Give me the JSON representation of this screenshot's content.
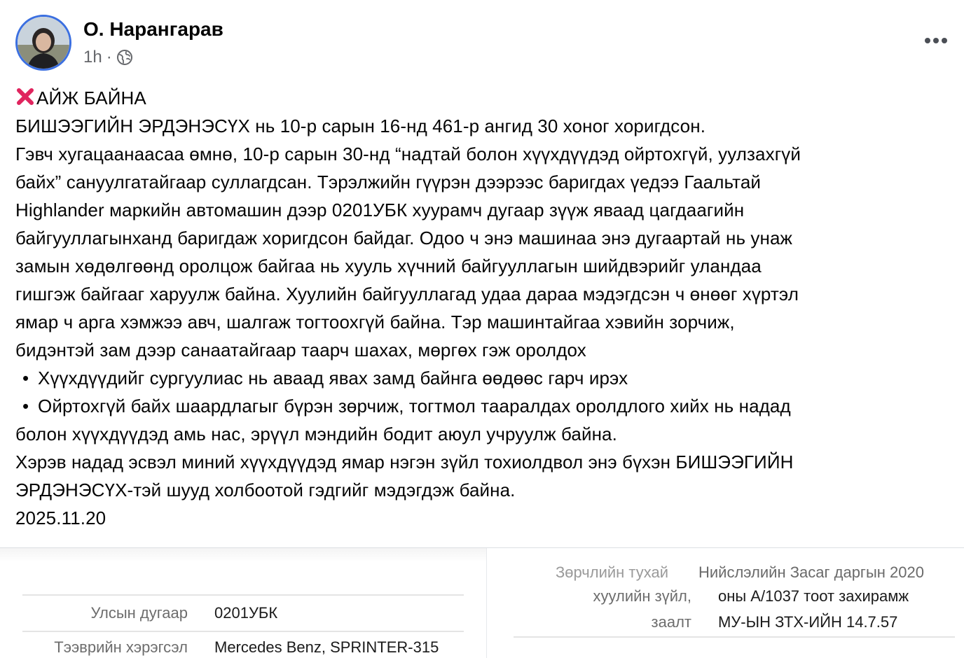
{
  "post": {
    "author": "О. Нарангарав",
    "time": "1h",
    "separator": "·",
    "privacy_icon": "globe-icon",
    "more_icon": "more-options-icon",
    "lines": {
      "title": "АЙЖ БАЙНА",
      "l1": "БИШЭЭГИЙН ЭРДЭНЭСҮХ нь 10-р сарын 16-нд 461-р ангид 30 хоног хоригдсон.",
      "l2": "Гэвч хугацаанаасаа өмнө, 10-р сарын 30-нд “надтай болон хүүхдүүдэд ойртохгүй, уулзахгүй",
      "l3": "байх” сануулгатайгаар суллагдсан. Тэрэлжийн гүүрэн дээрээс баригдах үедээ Гаальтай",
      "l4": "Highlander маркийн автомашин дээр 0201УБК хуурамч дугаар зүүж яваад цагдаагийн",
      "l5": "байгууллагынханд баригдаж хоригдсон байдаг. Одоо ч энэ машинаа энэ дугаартай нь унаж",
      "l6": "замын хөдөлгөөнд оролцож байгаа нь хууль хүчний байгууллагын шийдвэрийг уландаа",
      "l7": "гишгэж байгааг харуулж байна. Хуулийн байгууллагад удаа дараа мэдэгдсэн ч өнөөг хүртэл",
      "l8": "ямар ч арга хэмжээ авч, шалгаж тогтоохгүй байна. Тэр машинтайгаа хэвийн зорчиж,",
      "l9": "бидэнтэй зам дээр санаатайгаар таарч шахах, мөргөх гэж оролдох",
      "b1": "Хүүхдүүдийг сургуулиас нь аваад явах замд байнга өөдөөс гарч ирэх",
      "b2": "Ойртохгүй байх шаардлагыг бүрэн зөрчиж, тогтмол тааралдах оролдлого хийх  нь надад",
      "l10": "болон хүүхдүүдэд амь нас, эрүүл мэндийн бодит аюул учруулж байна.",
      "l11": "Хэрэв надад эсвэл миний хүүхдүүдэд ямар нэгэн зүйл тохиолдвол энэ бүхэн БИШЭЭГИЙН",
      "l12": "ЭРДЭНЭСҮХ-тэй шууд холбоотой гэдгийг мэдэгдэж байна.",
      "date": "2025.11.20"
    },
    "bullet_char": "•"
  },
  "attachments": {
    "left": {
      "rows": [
        {
          "label": "Улсын дугаар",
          "value": "0201УБК"
        },
        {
          "label": "Тээврийн хэрэгсэл",
          "value": "Mercedes Benz, SPRINTER-315"
        }
      ]
    },
    "right": {
      "cut_top": "Зөрчлийн тухай",
      "cut_top_value": "Нийслэлийн Засаг даргын 2020",
      "rows": [
        {
          "label": "хуулийн зүйл,",
          "value": "оны А/1037 тоот захирамж"
        },
        {
          "label": "заалт",
          "value": "МУ-ЫН ЗТХ-ИЙН 14.7.57"
        }
      ]
    }
  },
  "colors": {
    "avatar_ring": "#3b6fe0",
    "x_mark": "#e0245e",
    "meta_gray": "#65676b"
  }
}
